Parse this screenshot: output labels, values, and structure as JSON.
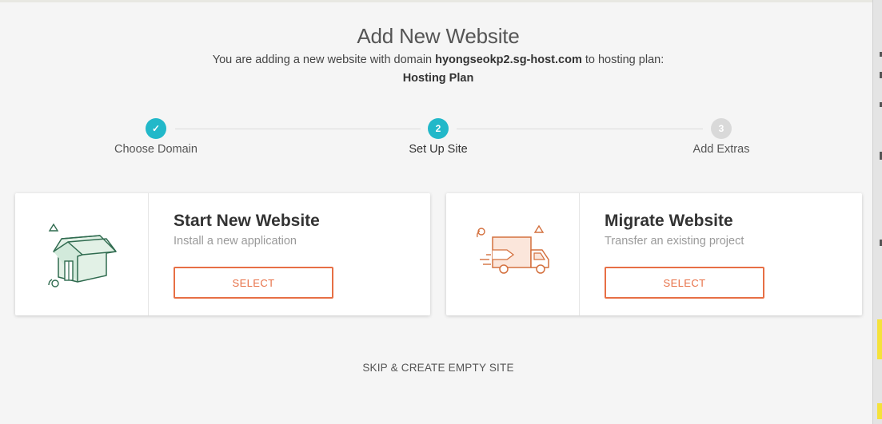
{
  "page": {
    "title": "Add New Website",
    "subtitle_prefix": "You are adding a new website with domain ",
    "domain": "hyongseokp2.sg-host.com",
    "subtitle_suffix": " to hosting plan:",
    "plan": "Hosting Plan"
  },
  "steps": [
    {
      "number": "✓",
      "label": "Choose Domain",
      "state": "done"
    },
    {
      "number": "2",
      "label": "Set Up Site",
      "state": "active"
    },
    {
      "number": "3",
      "label": "Add Extras",
      "state": "pending"
    }
  ],
  "cards": [
    {
      "title": "Start New Website",
      "description": "Install a new application",
      "button": "SELECT",
      "icon": "house-icon"
    },
    {
      "title": "Migrate Website",
      "description": "Transfer an existing project",
      "button": "SELECT",
      "icon": "delivery-truck-icon"
    }
  ],
  "skip_label": "SKIP & CREATE EMPTY SITE",
  "colors": {
    "accent": "#e76f45",
    "step_active": "#22b8c9",
    "step_pending": "#d9d9d9",
    "house": "#2f6b4f",
    "truck": "#d4703e"
  }
}
